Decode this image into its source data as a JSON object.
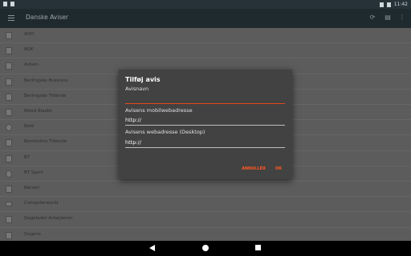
{
  "statusbar": {
    "time": "11:42",
    "icons": [
      "notification-icon",
      "sim-icon",
      "signal-icon",
      "battery-icon"
    ]
  },
  "appbar": {
    "title": "Danske Aviser",
    "icons": [
      "menu-icon",
      "refresh-icon",
      "add-file-icon",
      "overflow-menu-icon"
    ]
  },
  "list": {
    "items": [
      {
        "label": "AOH",
        "icon": "newspaper-icon"
      },
      {
        "label": "AOK",
        "icon": "newspaper-icon"
      },
      {
        "label": "Avisen",
        "icon": "newspaper-icon"
      },
      {
        "label": "Berlingske Business",
        "icon": "newspaper-icon"
      },
      {
        "label": "Berlingske Tidende",
        "icon": "newspaper-icon"
      },
      {
        "label": "Billed Bladet",
        "icon": "newspaper-icon"
      },
      {
        "label": "Bold",
        "icon": "soccer-ball-icon"
      },
      {
        "label": "Bornholms Tidende",
        "icon": "newspaper-icon"
      },
      {
        "label": "BT",
        "icon": "newspaper-icon"
      },
      {
        "label": "BT Sport",
        "icon": "soccer-ball-icon"
      },
      {
        "label": "Børsen",
        "icon": "newspaper-icon"
      },
      {
        "label": "Computerworld",
        "icon": "monitor-icon"
      },
      {
        "label": "Dagbladet Arbejderen",
        "icon": "newspaper-icon"
      },
      {
        "label": "Dagens",
        "icon": "newspaper-icon"
      }
    ]
  },
  "dialog": {
    "title": "Tilføj avis",
    "name_label": "Avisnavn",
    "name_value": "",
    "mobile_label": "Avisens mobilwebadresse",
    "mobile_value": "http://",
    "desktop_label": "Avisens webadresse (Desktop)",
    "desktop_value": "http://",
    "cancel_label": "ANNULLÉR",
    "ok_label": "OK"
  },
  "colors": {
    "accent": "#ff5722",
    "dialog_bg": "#424242",
    "appbar_bg": "#1f2a2f"
  }
}
